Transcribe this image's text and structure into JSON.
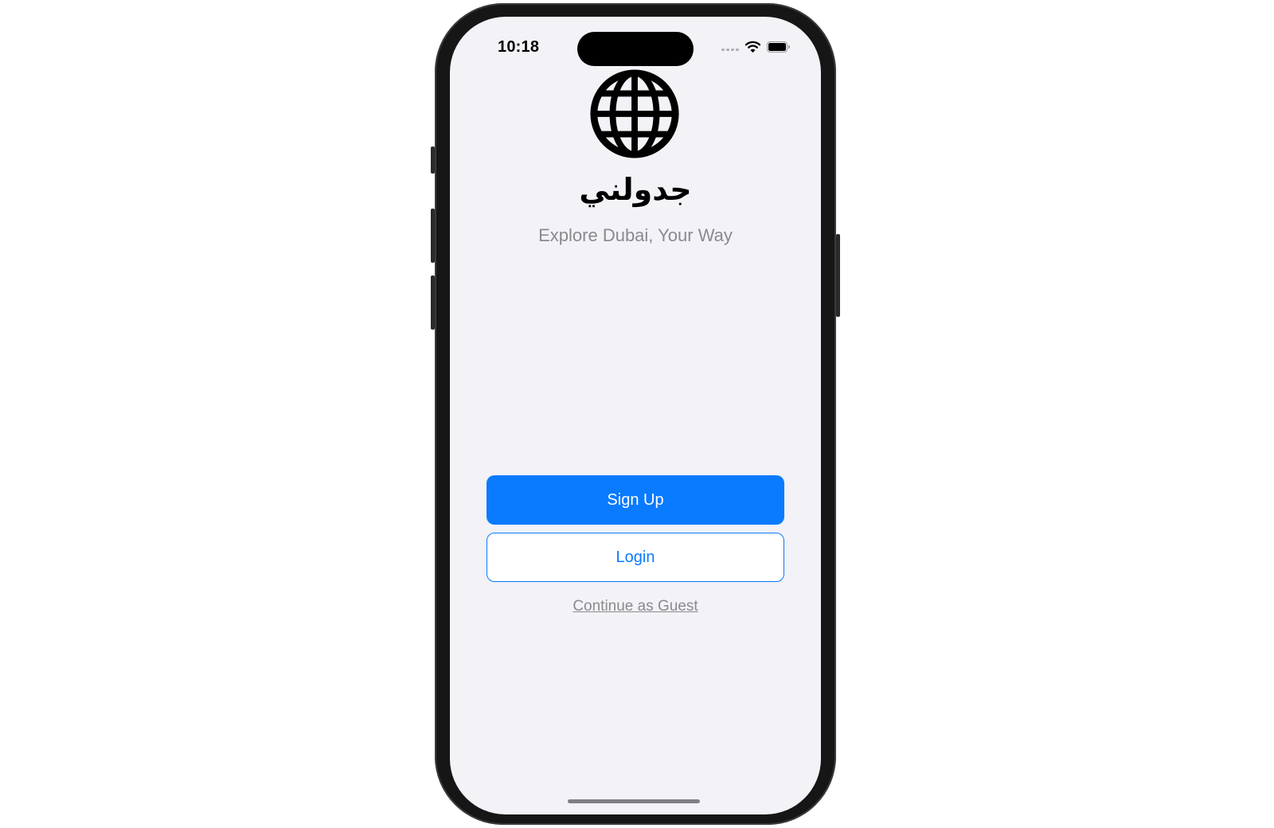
{
  "status_bar": {
    "time": "10:18",
    "icons": [
      "cellular-signal-icon",
      "wifi-icon",
      "battery-icon"
    ]
  },
  "app": {
    "logo_icon": "globe-icon",
    "title": "جدولني",
    "subtitle": "Explore Dubai, Your Way"
  },
  "actions": {
    "signup_label": "Sign Up",
    "login_label": "Login",
    "guest_label": "Continue as Guest"
  },
  "colors": {
    "accent": "#0a7aff",
    "background": "#f2f2f7",
    "secondary_text": "#8a8a8e"
  }
}
